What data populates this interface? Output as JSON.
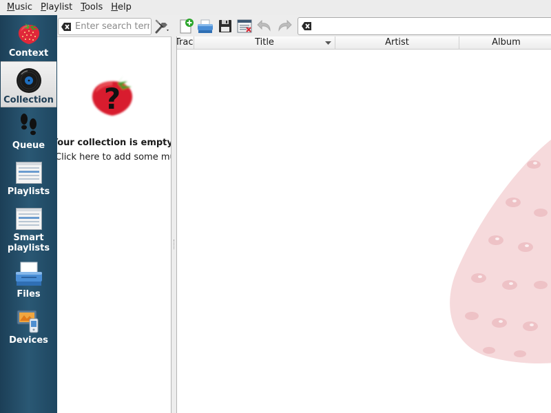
{
  "menu": [
    {
      "label": "Music",
      "mnemonic": "M",
      "rest": "usic"
    },
    {
      "label": "Playlist",
      "mnemonic": "P",
      "rest": "laylist"
    },
    {
      "label": "Tools",
      "mnemonic": "T",
      "rest": "ools"
    },
    {
      "label": "Help",
      "mnemonic": "H",
      "rest": "elp"
    }
  ],
  "sidebar": {
    "active": "Collection",
    "tabs": [
      {
        "label": "Context",
        "icon": "strawberry-icon"
      },
      {
        "label": "Collection",
        "icon": "vinyl-record-icon"
      },
      {
        "label": "Queue",
        "icon": "footprints-icon"
      },
      {
        "label": "Playlists",
        "icon": "playlist-window-icon"
      },
      {
        "label": "Smart\nplaylists",
        "label_line1": "Smart",
        "label_line2": "playlists",
        "icon": "smart-playlist-window-icon"
      },
      {
        "label": "Files",
        "icon": "printer-icon"
      },
      {
        "label": "Devices",
        "icon": "devices-icon"
      }
    ]
  },
  "library": {
    "search_placeholder": "Enter search terms here",
    "search_value": "",
    "empty_title": "Your collection is empty!",
    "empty_hint": "Click here to add some music"
  },
  "toolbar": {
    "buttons": [
      "new-playlist-icon",
      "load-playlist-icon",
      "save-playlist-icon",
      "clear-playlist-icon",
      "undo-icon",
      "redo-icon"
    ],
    "filter_value": ""
  },
  "playlist": {
    "columns": {
      "track": "Track",
      "title": "Title",
      "artist": "Artist",
      "album": "Album"
    },
    "sorted_column": "Title",
    "rows": []
  },
  "colors": {
    "sidebar_dark": "#1c3f57",
    "sidebar_mid": "#2a5874",
    "strawberry": "#e0283a",
    "watermark": "#f3d6d8"
  }
}
